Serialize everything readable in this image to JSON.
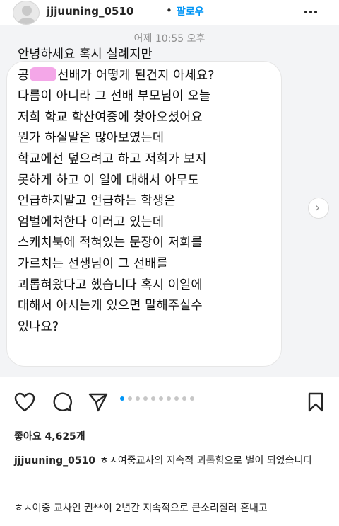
{
  "header": {
    "username": "jjjuuning_0510",
    "separator": "•",
    "follow_label": "팔로우"
  },
  "post": {
    "timestamp": "어제 10:55 오후",
    "message": {
      "line1": "안녕하세요 혹시 실례지만",
      "line2_prefix": "공",
      "line2_suffix": "선배가 어떻게 된건지 아세요?",
      "line3": "다름이 아니라 그 선배 부모님이 오늘",
      "line4": "저희 학교 학산여중에 찾아오셨어요",
      "line5": "뭔가 하실말은 많아보였는데",
      "line6": "학교에선 덮으려고 하고 저희가 보지",
      "line7": "못하게 하고 이 일에 대해서 아무도",
      "line8": "언급하지말고 언급하는 학생은",
      "line9": "엄벌에처한다 이러고 있는데",
      "line10": "스캐치북에 적혀있는 문장이 저희를",
      "line11": "가르치는 선생님이 그 선배를",
      "line12": "괴롭혀왔다고 했습니다 혹시 이일에",
      "line13": "대해서 아시는게 있으면 말해주실수",
      "line14": "있나요?"
    },
    "carousel": {
      "total": 10,
      "active_index": 0
    }
  },
  "engagement": {
    "likes_text": "좋아요 4,625개"
  },
  "caption": {
    "username": "jjjuuning_0510",
    "text": "ㅎㅅ여중교사의 지속적 괴롭힘으로 별이 되었습니다",
    "next_line": "ㅎㅅ여중 교사인 권**이 2년간 지속적으로 큰소리질러 혼내고"
  },
  "colors": {
    "accent": "#0095f6",
    "redaction": "#f4a7e8",
    "text": "#262626",
    "muted": "#8e8e8e"
  },
  "icons": [
    "more-icon",
    "heart-icon",
    "comment-icon",
    "share-icon",
    "bookmark-icon",
    "chevron-right-icon"
  ]
}
